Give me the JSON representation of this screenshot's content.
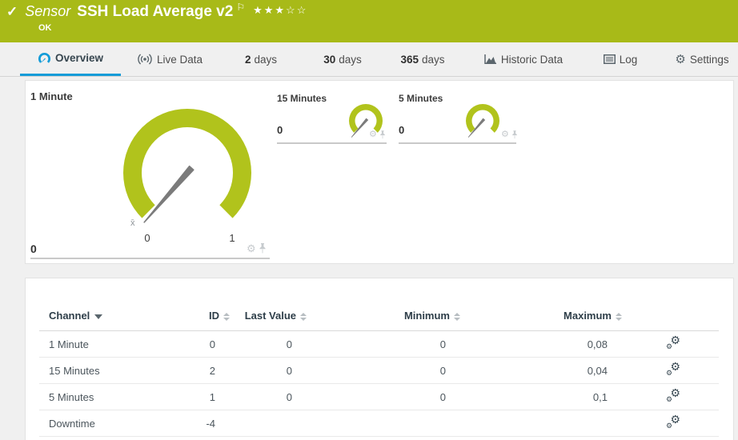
{
  "header": {
    "kind_label": "Sensor",
    "title": "SSH Load Average v2",
    "status": "OK",
    "stars_display": "★★★☆☆",
    "rating_filled": 3,
    "rating_total": 5
  },
  "tabs": [
    {
      "label": "Overview",
      "icon": "gauge-icon",
      "active": true
    },
    {
      "label": "Live Data",
      "icon": "broadcast-icon",
      "active": false
    },
    {
      "number": "2",
      "label": "days",
      "active": false
    },
    {
      "number": "30",
      "label": "days",
      "active": false
    },
    {
      "number": "365",
      "label": "days",
      "active": false
    },
    {
      "label": "Historic Data",
      "icon": "area-chart-icon",
      "active": false
    },
    {
      "label": "Log",
      "icon": "log-icon",
      "active": false
    },
    {
      "label": "Settings",
      "icon": "gear-icon",
      "active": false
    }
  ],
  "gauges": [
    {
      "name": "1 Minute",
      "value": "0",
      "scale_min": "0",
      "scale_max": "1",
      "avg_marker": "x̄"
    },
    {
      "name": "15 Minutes",
      "value": "0"
    },
    {
      "name": "5 Minutes",
      "value": "0"
    }
  ],
  "chart_data": [
    {
      "type": "gauge",
      "title": "1 Minute",
      "value": 0,
      "axis_min": 0,
      "axis_max": 1
    },
    {
      "type": "gauge",
      "title": "15 Minutes",
      "value": 0
    },
    {
      "type": "gauge",
      "title": "5 Minutes",
      "value": 0
    }
  ],
  "table": {
    "headers": {
      "channel": "Channel",
      "id": "ID",
      "last": "Last Value",
      "min": "Minimum",
      "max": "Maximum"
    },
    "rows": [
      {
        "channel": "1 Minute",
        "id": "0",
        "last": "0",
        "min": "0",
        "max": "0,08"
      },
      {
        "channel": "15 Minutes",
        "id": "2",
        "last": "0",
        "min": "0",
        "max": "0,04"
      },
      {
        "channel": "5 Minutes",
        "id": "1",
        "last": "0",
        "min": "0",
        "max": "0,1"
      },
      {
        "channel": "Downtime",
        "id": "-4",
        "last": "",
        "min": "",
        "max": ""
      }
    ]
  },
  "colors": {
    "status_up_green": "#a8ba18",
    "gauge_green": "#b1c31c",
    "accent_blue": "#149cd8"
  }
}
